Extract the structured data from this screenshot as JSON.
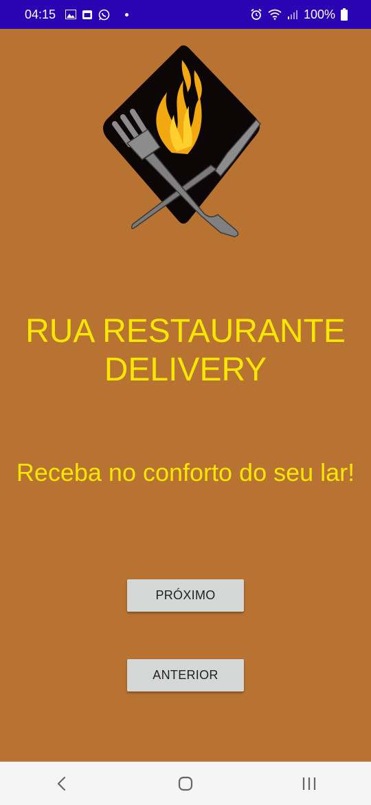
{
  "status_bar": {
    "time": "04:15",
    "battery": "100%",
    "left_icons": [
      "image-icon",
      "calendar-icon",
      "whatsapp-icon",
      "dot-icon"
    ],
    "right_icons": [
      "alarm-icon",
      "wifi-icon",
      "signal-icon",
      "battery-icon"
    ],
    "background_color": "#2A03B3"
  },
  "main": {
    "title": "RUA RESTAURANTE DELIVERY",
    "subtitle": "Receba no conforto do seu lar!",
    "next_button": "PRÓXIMO",
    "previous_button": "ANTERIOR",
    "background_color": "#B87333",
    "text_color": "#F7E600"
  },
  "nav_bar": {
    "buttons": [
      "back-icon",
      "home-icon",
      "recents-icon"
    ]
  }
}
